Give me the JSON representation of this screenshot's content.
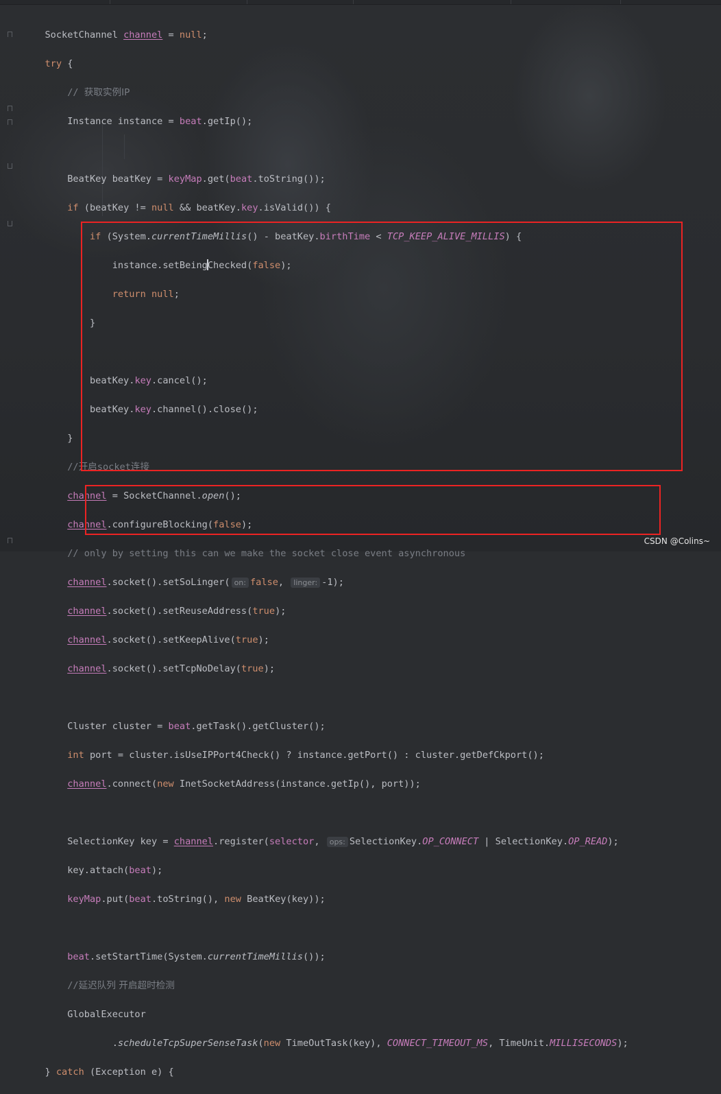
{
  "editor": {
    "language": "Java",
    "colors": {
      "background": "#2b2d30",
      "text": "#bcbec4",
      "keyword": "#cf8e6d",
      "field": "#c77dbb",
      "comment": "#7a7e85",
      "highlight_box": "#ec2323"
    },
    "lines": {
      "l01": {
        "a": "SocketChannel ",
        "b": "channel",
        "c": " = ",
        "d": "null",
        "e": ";"
      },
      "l02": {
        "a": "try",
        "b": " {"
      },
      "l03": {
        "a": "// ",
        "b": "获取实例IP"
      },
      "l04": {
        "a": "Instance instance = ",
        "b": "beat",
        "c": ".getIp();"
      },
      "l06": {
        "a": "BeatKey beatKey = ",
        "b": "keyMap",
        "c": ".get(",
        "d": "beat",
        "e": ".toString());"
      },
      "l07": {
        "a": "if",
        "b": " (beatKey != ",
        "c": "null",
        "d": " && beatKey.",
        "e": "key",
        "f": ".isValid()) {"
      },
      "l08": {
        "a": "if",
        "b": " (System.",
        "c": "currentTimeMillis",
        "d": "() - beatKey.",
        "e": "birthTime",
        "f": " < ",
        "g": "TCP_KEEP_ALIVE_MILLIS",
        "h": ") {"
      },
      "l09": {
        "a": "instance.setBeing",
        "b": "Checked(",
        "c": "false",
        "d": ");"
      },
      "l10": {
        "a": "return",
        "b": " ",
        "c": "null",
        "d": ";"
      },
      "l11": {
        "a": "}"
      },
      "l13": {
        "a": "beatKey.",
        "b": "key",
        "c": ".cancel();"
      },
      "l14": {
        "a": "beatKey.",
        "b": "key",
        "c": ".channel().close();"
      },
      "l15": {
        "a": "}"
      },
      "l16": {
        "a": "//",
        "b": "开启",
        "c": "socket",
        "d": "连接"
      },
      "l17": {
        "a": "channel",
        "b": " = SocketChannel.",
        "c": "open",
        "d": "();"
      },
      "l18": {
        "a": "channel",
        "b": ".configureBlocking(",
        "c": "false",
        "d": ");"
      },
      "l19": {
        "a": "// only by setting this can we make the socket close event asynchronous"
      },
      "l20": {
        "a": "channel",
        "b": ".socket().setSoLinger(",
        "c": "on:",
        "d": "false",
        "e": ", ",
        "f": "linger:",
        "g": "-1);"
      },
      "l21": {
        "a": "channel",
        "b": ".socket().setReuseAddress(",
        "c": "true",
        "d": ");"
      },
      "l22": {
        "a": "channel",
        "b": ".socket().setKeepAlive(",
        "c": "true",
        "d": ");"
      },
      "l23": {
        "a": "channel",
        "b": ".socket().setTcpNoDelay(",
        "c": "true",
        "d": ");"
      },
      "l25": {
        "a": "Cluster cluster = ",
        "b": "beat",
        "c": ".getTask().getCluster();"
      },
      "l26": {
        "a": "int",
        "b": " port = cluster.isUseIPPort4Check() ? instance.getPort() : cluster.getDefCkport();"
      },
      "l27": {
        "a": "channel",
        "b": ".connect(",
        "c": "new",
        "d": " InetSocketAddress(instance.getIp(), port));"
      },
      "l29": {
        "a": "SelectionKey key = ",
        "b": "channel",
        "c": ".register(",
        "d": "selector",
        "e": ", ",
        "f": "ops:",
        "g": "SelectionKey.",
        "h": "OP_CONNECT",
        "i": " | SelectionKey.",
        "j": "OP_READ",
        "k": ");"
      },
      "l30": {
        "a": "key.attach(",
        "b": "beat",
        "c": ");"
      },
      "l31": {
        "a": "keyMap",
        "b": ".put(",
        "c": "beat",
        "d": ".toString(), ",
        "e": "new",
        "f": " BeatKey(key));"
      },
      "l33": {
        "a": "beat",
        "b": ".setStartTime(System.",
        "c": "currentTimeMillis",
        "d": "());"
      },
      "l34": {
        "a": "//",
        "b": "延迟队列 开启超时检测"
      },
      "l35": {
        "a": "GlobalExecutor"
      },
      "l36": {
        "a": ".",
        "b": "scheduleTcpSuperSenseTask",
        "c": "(",
        "d": "new",
        "e": " TimeOutTask(key), ",
        "f": "CONNECT_TIMEOUT_MS",
        "g": ", TimeUnit.",
        "h": "MILLISECONDS",
        "i": ");"
      },
      "l37": {
        "a": "} ",
        "b": "catch",
        "c": " (Exception e) {"
      }
    }
  },
  "watermark": "CSDN @Colins~"
}
